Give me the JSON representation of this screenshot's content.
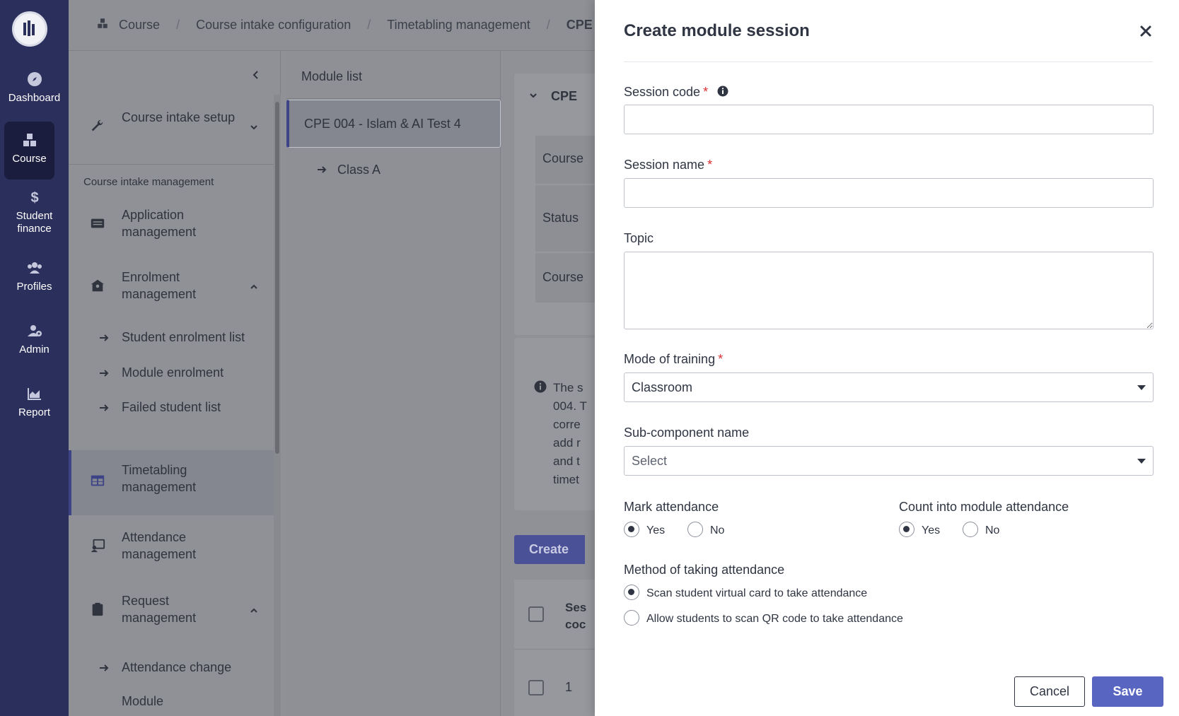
{
  "rail": {
    "items": [
      {
        "label": "Dashboard",
        "icon": "compass-icon"
      },
      {
        "label": "Course",
        "icon": "cubes-icon",
        "active": true
      },
      {
        "label": "Student finance",
        "icon": "dollar-icon"
      },
      {
        "label": "Profiles",
        "icon": "users-icon"
      },
      {
        "label": "Admin",
        "icon": "user-gear-icon"
      },
      {
        "label": "Report",
        "icon": "chart-icon"
      }
    ]
  },
  "breadcrumb": {
    "items": [
      "Course",
      "Course intake configuration",
      "Timetabling management",
      "CPE"
    ]
  },
  "sidenav": {
    "setup_label": "Course intake setup",
    "section_label": "Course intake management",
    "application": "Application management",
    "enrolment": "Enrolment management",
    "enrolment_sub": [
      "Student enrolment list",
      "Module enrolment",
      "Failed student list"
    ],
    "timetabling": "Timetabling management",
    "attendance": "Attendance management",
    "request": "Request management",
    "request_sub": [
      "Attendance change",
      "Module"
    ]
  },
  "module_list": {
    "title": "Module list",
    "selected": "CPE 004 - Islam & AI Test 4",
    "class_item": "Class A"
  },
  "content": {
    "card_title": "CPE",
    "rows": [
      "Course",
      "Status",
      "Course"
    ],
    "info_text": "The s\n004. T\ncorre\nadd r\nand t\ntimet",
    "create_label": "Create",
    "table_header": "Ses\ncoc",
    "row_number": "1"
  },
  "drawer": {
    "title": "Create module session",
    "session_code": {
      "label": "Session code",
      "value": ""
    },
    "session_name": {
      "label": "Session name",
      "value": ""
    },
    "topic": {
      "label": "Topic",
      "value": ""
    },
    "mode": {
      "label": "Mode of training",
      "value": "Classroom"
    },
    "subcomponent": {
      "label": "Sub-component name",
      "placeholder": "Select"
    },
    "mark_attendance": {
      "label": "Mark attendance",
      "yes": "Yes",
      "no": "No",
      "selected": "Yes"
    },
    "count_attendance": {
      "label": "Count into module attendance",
      "yes": "Yes",
      "no": "No",
      "selected": "Yes"
    },
    "method": {
      "label": "Method of taking attendance",
      "options": [
        "Scan student virtual card to take attendance",
        "Allow students to scan QR code to take attendance"
      ],
      "selected": 0
    },
    "cancel_label": "Cancel",
    "save_label": "Save"
  },
  "colors": {
    "rail": "#2b2f5c",
    "accent": "#5865c1",
    "required": "#d63031"
  }
}
